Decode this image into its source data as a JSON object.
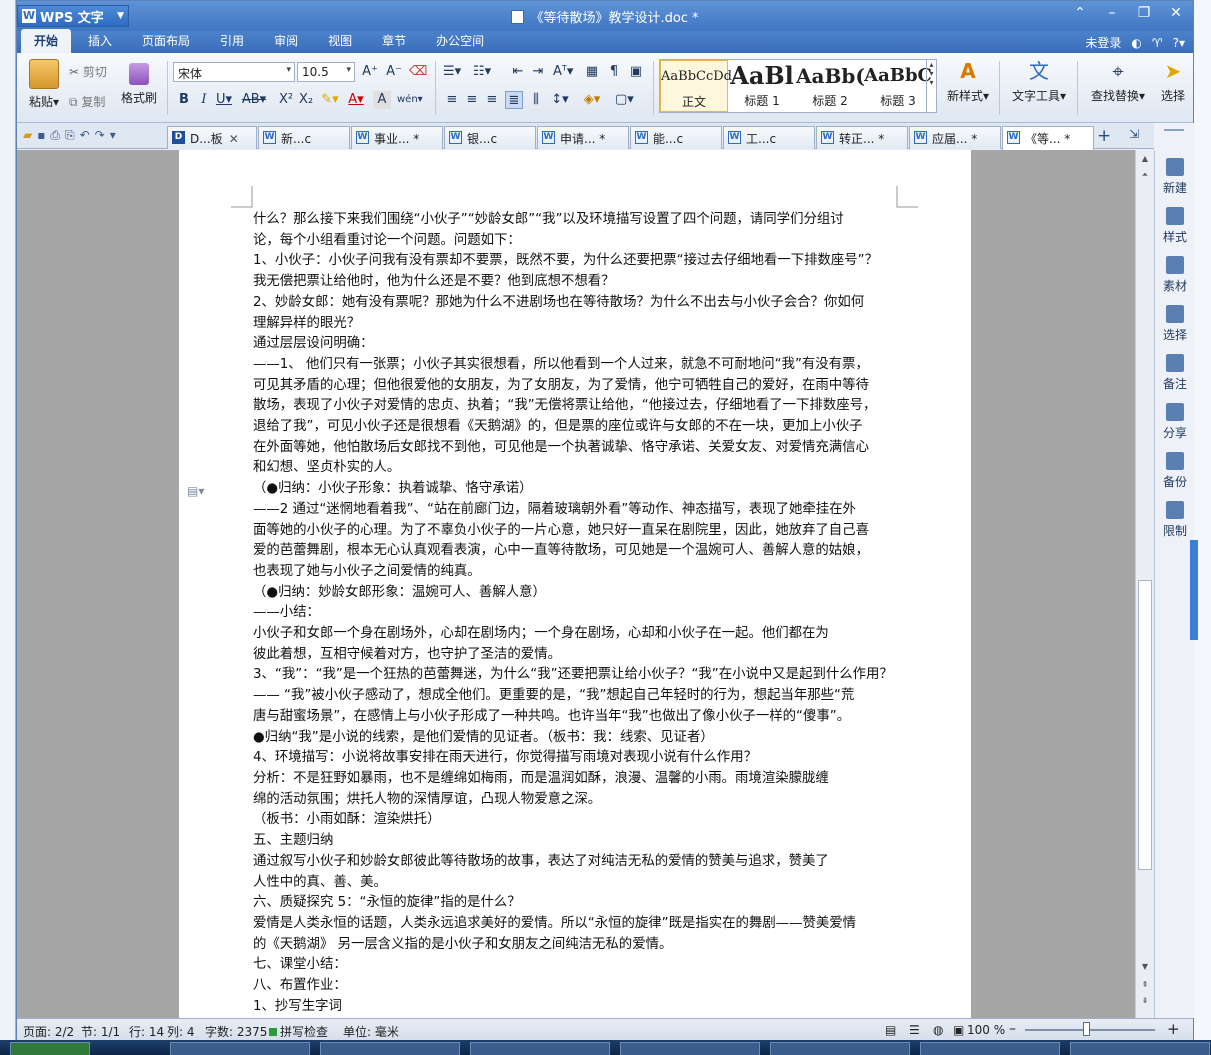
{
  "app": {
    "name": "WPS 文字",
    "doc_title": "《等待散场》教学设计.doc *"
  },
  "menu": {
    "tabs": [
      "开始",
      "插入",
      "页面布局",
      "引用",
      "审阅",
      "视图",
      "章节",
      "办公空间"
    ],
    "login": "未登录"
  },
  "ribbon": {
    "paste": "粘贴",
    "cut": "剪切",
    "copy": "复制",
    "format_painter": "格式刷",
    "font_name": "宋体",
    "font_size": "10.5",
    "styles": [
      {
        "preview": "AaBbCcDd",
        "name": "正文"
      },
      {
        "preview": "AaBl",
        "name": "标题 1"
      },
      {
        "preview": "AaBb(",
        "name": "标题 2"
      },
      {
        "preview": "AaBbC",
        "name": "标题 3"
      }
    ],
    "new_style": "新样式",
    "text_tools": "文字工具",
    "find_replace": "查找替换",
    "select": "选择"
  },
  "doc_tabs": [
    "D...板",
    "新...c",
    "事业... *",
    "银...c",
    "申请... *",
    "能...c",
    "工...c",
    "转正... *",
    "应届... *",
    "《等... *"
  ],
  "side_panel": [
    "新建",
    "样式",
    "素材",
    "选择",
    "备注",
    "分享",
    "备份",
    "限制"
  ],
  "document": {
    "lines": [
      "什么？那么接下来我们围绕“小伙子”“妙龄女郎”“我”以及环境描写设置了四个问题，请同学们分组讨",
      "论，每个小组看重讨论一个问题。问题如下：",
      "1、小伙子：小伙子问我有没有票却不要票，既然不要，为什么还要把票“接过去仔细地看一下排数座号”？",
      "我无偿把票让给他时，他为什么还是不要？他到底想不想看？",
      "2、妙龄女郎：她有没有票呢？那她为什么不进剧场也在等待散场？为什么不出去与小伙子会合？你如何",
      "理解异样的眼光？",
      "通过层层设问明确：",
      "——1、 他们只有一张票；小伙子其实很想看，所以他看到一个人过来，就急不可耐地问“我”有没有票，",
      "可见其矛盾的心理；但他很爱他的女朋友，为了女朋友，为了爱情，他宁可牺牲自己的爱好，在雨中等待",
      "散场，表现了小伙子对爱情的忠贞、执着；“我”无偿将票让给他，“他接过去，仔细地看了一下排数座号，",
      "退给了我”，可见小伙子还是很想看《天鹅湖》的，但是票的座位或许与女郎的不在一块，更加上小伙子",
      "在外面等她，他怕散场后女郎找不到他，可见他是一个执著诚挚、恪守承诺、关爱女友、对爱情充满信心",
      "和幻想、坚贞朴实的人。",
      "（●归纳：小伙子形象：执着诚挚、恪守承诺）",
      "——2 通过“迷惘地看着我”、“站在前廊门边，隔着玻璃朝外看”等动作、神态描写，表现了她牵挂在外",
      "面等她的小伙子的心理。为了不辜负小伙子的一片心意，她只好一直呆在剧院里，因此，她放弃了自己喜",
      "爱的芭蕾舞剧，根本无心认真观看表演，心中一直等待散场，可见她是一个温婉可人、善解人意的姑娘，",
      "也表现了她与小伙子之间爱情的纯真。",
      "（●归纳：妙龄女郎形象：温婉可人、善解人意）",
      "——小结：",
      "        小伙子和女郎一个身在剧场外，心却在剧场内；一个身在剧场，心却和小伙子在一起。他们都在为",
      "彼此着想，互相守候着对方，也守护了圣洁的爱情。",
      "3、“我”：“我”是一个狂热的芭蕾舞迷，为什么“我”还要把票让给小伙子？“我”在小说中又是起到什么作用？",
      "——  “我”被小伙子感动了，想成全他们。更重要的是，“我”想起自己年轻时的行为，想起当年那些“荒",
      "唐与甜蜜场景”，在感情上与小伙子形成了一种共鸣。也许当年“我”也做出了像小伙子一样的“傻事”。",
      "●归纳“我”是小说的线索，是他们爱情的见证者。（板书：我：线索、见证者）",
      "4、环境描写：小说将故事安排在雨天进行，你觉得描写雨境对表现小说有什么作用？",
      "        分析：不是狂野如暴雨，也不是缠绵如梅雨，而是温润如酥，浪漫、温馨的小雨。雨境渲染朦胧缠",
      "绵的活动氛围；烘托人物的深情厚谊，凸现人物爱意之深。",
      "        （板书：小雨如酥：渲染烘托）",
      "五、主题归纳",
      "        通过叙写小伙子和妙龄女郎彼此等待散场的故事，表达了对纯洁无私的爱情的赞美与追求，赞美了",
      "人性中的真、善、美。",
      "六、质疑探究 5：“永恒的旋律”指的是什么？",
      "爱情是人类永恒的话题，人类永远追求美好的爱情。所以“永恒的旋律”既是指实在的舞剧——赞美爱情",
      "的《天鹅湖》 另一层含义指的是小伙子和女朋友之间纯洁无私的爱情。",
      "七、课堂小结：",
      "八、布置作业：",
      "1、抄写生字词"
    ]
  },
  "status": {
    "page": "页面: 2/2",
    "section": "节: 1/1",
    "row": "行: 14",
    "col": "列: 4",
    "words": "字数: 2375",
    "spell": "拼写检查",
    "unit": "单位: 毫米",
    "zoom": "100 %",
    "zoom_value": 100
  }
}
